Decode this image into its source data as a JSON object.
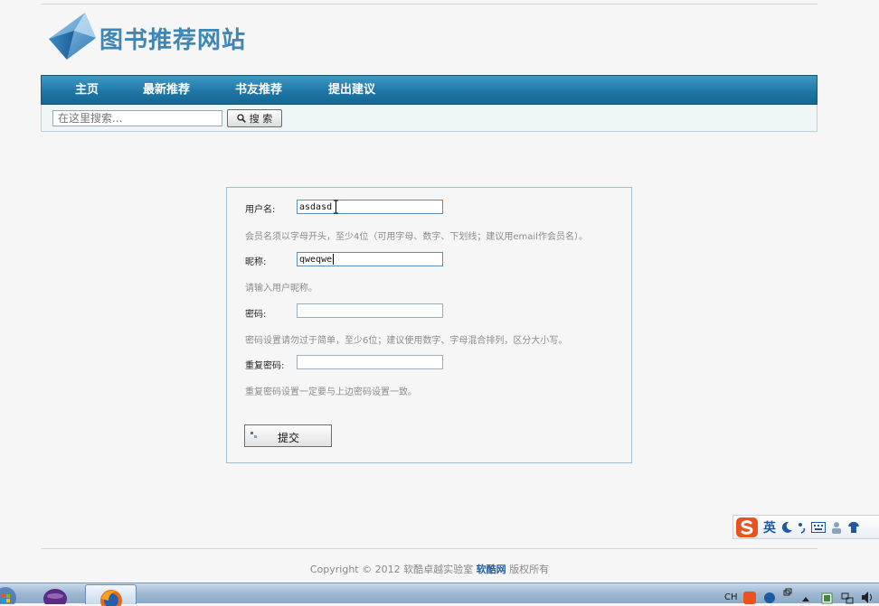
{
  "site": {
    "logo_text": "图书推荐网站"
  },
  "nav": {
    "items": [
      "主页",
      "最新推荐",
      "书友推荐",
      "提出建议"
    ]
  },
  "search": {
    "placeholder": "在这里搜索...",
    "button_label": "搜 索"
  },
  "form": {
    "username_label": "用户名:",
    "username_value": "asdasd",
    "username_hint": "会员名须以字母开头，至少4位（可用字母、数字、下划线；建议用email作会员名）。",
    "nickname_label": "昵称:",
    "nickname_value": "qweqwe",
    "nickname_hint": "请输入用户昵称。",
    "password_label": "密码:",
    "password_value": "",
    "password_hint": "密码设置请勿过于简单，至少6位；建议使用数字、字母混合排列，区分大小写。",
    "confirm_label": "重复密码:",
    "confirm_value": "",
    "confirm_hint": "重复密码设置一定要与上边密码设置一致。",
    "submit_label": "提交"
  },
  "footer": {
    "copyright_prefix": "Copyright © 2012 软酷卓越实验室",
    "brand": "软酷网",
    "copyright_suffix": "版权所有"
  },
  "ime": {
    "mode_label": "英"
  },
  "taskbar": {
    "tray_lang": "CH"
  },
  "colors": {
    "nav_blue": "#1f77a6",
    "logo_blue": "#3f86b5",
    "panel_border": "#9fc0d3",
    "brand_link": "#245f9c"
  }
}
